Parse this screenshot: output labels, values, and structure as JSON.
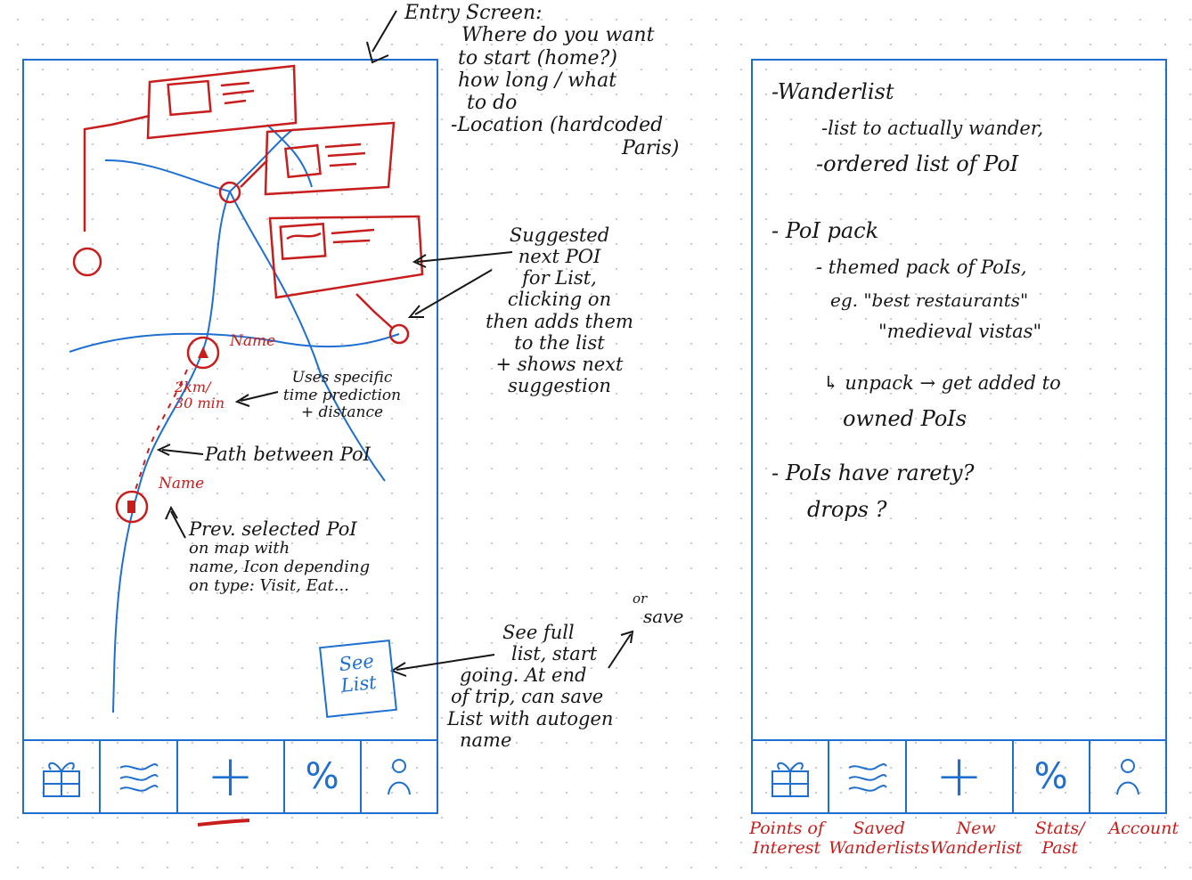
{
  "left_screen": {
    "entry_note": {
      "title": "Entry Screen:",
      "lines": [
        "Where do you want",
        "to start (home?)",
        "how long / what",
        "to do",
        "-Location (hardcoded",
        "Paris)"
      ]
    },
    "poi_labels": [
      "Name",
      "Name"
    ],
    "suggested_note": [
      "Suggested",
      "next POI",
      "for List,",
      "clicking on",
      "then adds them",
      "to the list",
      "+ shows next",
      "suggestion"
    ],
    "time_distance": [
      "2km/",
      "30 min"
    ],
    "uses_note": [
      "Uses specific",
      "time prediction",
      "+ distance"
    ],
    "path_note": "Path between PoI",
    "prev_note": [
      "Prev. selected PoI",
      "on map with",
      "name, Icon depending",
      "on type: Visit, Eat..."
    ],
    "see_list_button": [
      "See",
      "List"
    ],
    "see_full_note": [
      "See full",
      "list, start",
      "going. At end",
      "of trip, can save",
      "List with autogen",
      "name"
    ],
    "or_save_note": [
      "or",
      "save"
    ]
  },
  "right_screen": {
    "notes": [
      "-Wanderlist",
      "-list to actually wander,",
      "-ordered list of PoI",
      "- PoI pack",
      "- themed pack of PoIs,",
      "eg. \"best restaurants\"",
      "\"medieval vistas\"",
      "↳ unpack → get added to",
      "owned PoIs",
      "- PoIs have rarety?",
      "drops ?"
    ]
  },
  "nav": {
    "icons": [
      "gift-icon",
      "waves-icon",
      "plus-icon",
      "percent-icon",
      "person-icon"
    ],
    "plus_symbol": "+",
    "percent_symbol": "%",
    "labels": [
      "Points of Interest",
      "Saved Wanderlists",
      "New Wanderlist",
      "Stats/ Past",
      "Account"
    ]
  },
  "colors": {
    "blue": "#1f6fd1",
    "red": "#c81d1d",
    "ink": "#161616"
  }
}
